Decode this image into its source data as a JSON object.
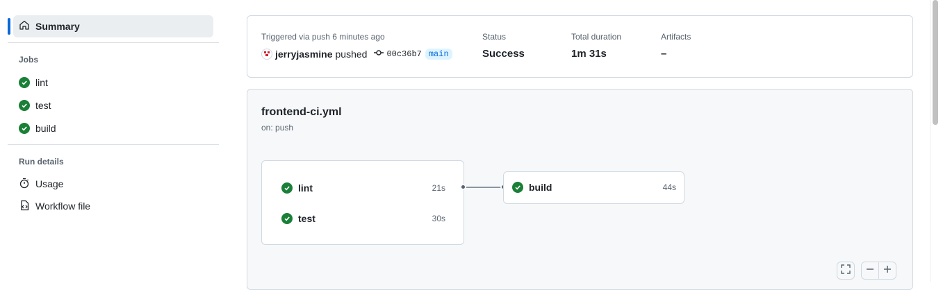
{
  "sidebar": {
    "summary_label": "Summary",
    "jobs_heading": "Jobs",
    "jobs": [
      {
        "label": "lint"
      },
      {
        "label": "test"
      },
      {
        "label": "build"
      }
    ],
    "run_details_heading": "Run details",
    "run_details": [
      {
        "label": "Usage",
        "icon": "stopwatch-icon"
      },
      {
        "label": "Workflow file",
        "icon": "file-code-icon"
      }
    ]
  },
  "run": {
    "trigger_text": "Triggered via push 6 minutes ago",
    "user": "jerryjasmine",
    "action": "pushed",
    "commit_sha": "00c36b7",
    "branch": "main",
    "status_label": "Status",
    "status_value": "Success",
    "duration_label": "Total duration",
    "duration_value": "1m 31s",
    "artifacts_label": "Artifacts",
    "artifacts_value": "–"
  },
  "workflow": {
    "file": "frontend-ci.yml",
    "trigger": "on: push",
    "jobs": [
      {
        "name": "lint",
        "duration": "21s"
      },
      {
        "name": "test",
        "duration": "30s"
      },
      {
        "name": "build",
        "duration": "44s"
      }
    ]
  },
  "colors": {
    "success": "#1a7f37",
    "accent": "#0969da"
  }
}
